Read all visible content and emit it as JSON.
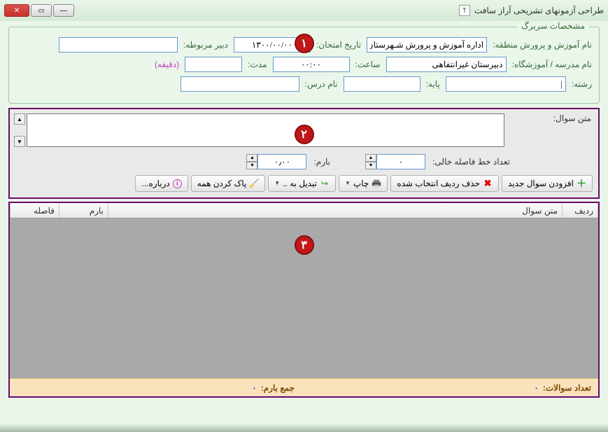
{
  "window_title": "طراحی آزمونهای تشریحی آراز سافت",
  "header": {
    "legend": "مشخصات سربرگ",
    "region_label": "نام آموزش و پرورش منطقه:",
    "region_value": "اداره آموزش و پرورش شـهرستان",
    "exam_date_label": "تاریخ امتحان:",
    "exam_date_value": "۱۳۰۰/۰۰/۰۰",
    "teacher_label": "دبیر مربوطه:",
    "teacher_value": "",
    "school_label": "نام مدرسه / آموزشگاه:",
    "school_value": "دبیرستان غیرانتفاهی",
    "time_label": "ساعت:",
    "time_value": "۰۰:۰۰",
    "duration_label": "مدت:",
    "duration_unit": "(دقیقه)",
    "duration_value": "",
    "field_label": "رشته:",
    "field_value": "|",
    "grade_label": "پایه:",
    "grade_value": "",
    "course_label": "نام درس:",
    "course_value": ""
  },
  "question": {
    "text_label": "متن سوال:",
    "text_value": "",
    "empty_lines_label": "تعداد خط فاصله خالی:",
    "empty_lines_value": "۰",
    "score_label": "بارم:",
    "score_value": "۰٫۰۰"
  },
  "toolbar": {
    "add": "افزودن سوال جدید",
    "delete": "حذف ردیف انتخاب شده",
    "print": "چاپ",
    "convert": "تبدیل به ..",
    "clear": "پاک کردن همه",
    "about": "درباره..."
  },
  "grid": {
    "col_row": "ردیف",
    "col_text": "متن سوال",
    "col_score": "بارم",
    "col_gap": "فاصله"
  },
  "summary": {
    "count_label": "تعداد سوالات:",
    "count_value": "۰",
    "total_label": "جمع بارم:",
    "total_value": "۰"
  },
  "badges": {
    "b1": "۱",
    "b2": "۲",
    "b3": "۳"
  }
}
